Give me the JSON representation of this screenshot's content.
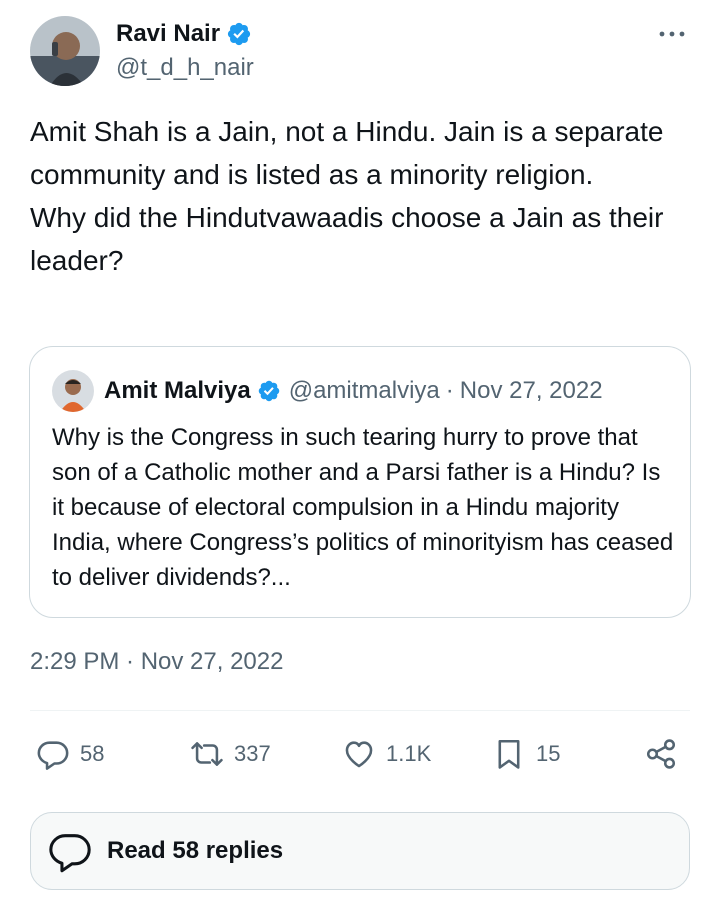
{
  "author": {
    "display_name": "Ravi Nair",
    "handle": "@t_d_h_nair",
    "verified": true
  },
  "tweet": {
    "text": "Amit Shah is a Jain, not a Hindu. Jain is a separate community and is listed as a minority religion.\nWhy did the Hindutvawaadis choose a Jain as their leader?",
    "timestamp": "2:29 PM · Nov 27, 2022"
  },
  "quote": {
    "display_name": "Amit Malviya",
    "handle": "@amitmalviya",
    "separator": "·",
    "date": "Nov 27, 2022",
    "verified": true,
    "text": "Why is the Congress in such tearing hurry to prove that son of a Catholic mother and a Parsi father is a Hindu? Is it because of electoral compulsion in a Hindu majority India, where Congress’s politics of minorityism has ceased to deliver dividends?..."
  },
  "actions": {
    "replies": "58",
    "reposts": "337",
    "likes": "1.1K",
    "bookmarks": "15"
  },
  "read_replies": {
    "label": "Read 58 replies"
  },
  "colors": {
    "text_primary": "#0f1419",
    "text_secondary": "#536471",
    "verified_blue": "#1d9bf0",
    "border": "#cfd9de"
  },
  "icons": [
    "more-icon",
    "verified-badge-icon",
    "reply-icon",
    "repost-icon",
    "like-icon",
    "bookmark-icon",
    "share-icon",
    "reply-bubble-icon"
  ]
}
